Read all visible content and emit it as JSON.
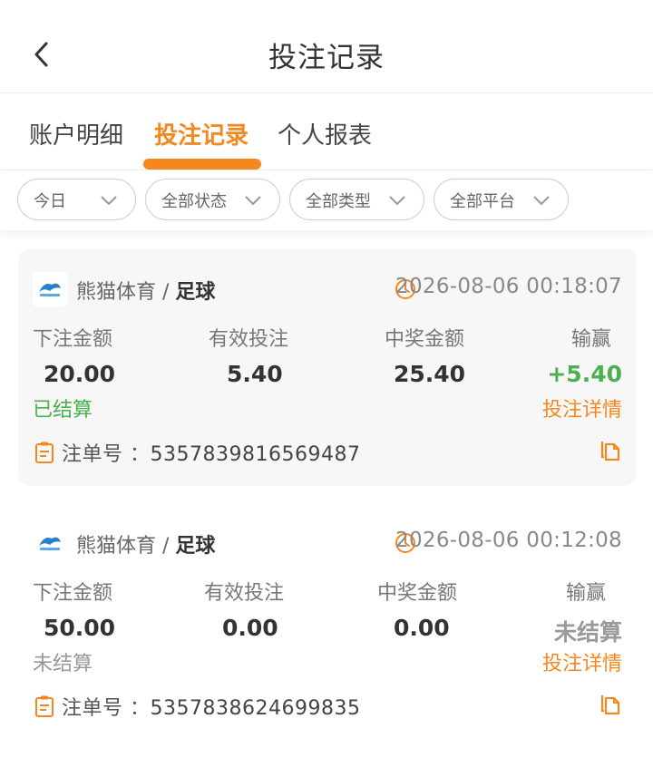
{
  "header": {
    "title": "投注记录",
    "back_icon": "chevron-left-icon"
  },
  "tabs": [
    {
      "label": "账户明细",
      "active": false
    },
    {
      "label": "投注记录",
      "active": true
    },
    {
      "label": "个人报表",
      "active": false
    }
  ],
  "filters": [
    {
      "label": "今日"
    },
    {
      "label": "全部状态"
    },
    {
      "label": "全部类型"
    },
    {
      "label": "全部平台"
    }
  ],
  "labels": {
    "bet_amount": "下注金额",
    "valid_bet": "有效投注",
    "win_amount": "中奖金额",
    "profit": "输赢",
    "detail": "投注详情",
    "order_no": "注单号"
  },
  "records": [
    {
      "platform": "熊猫体育",
      "separator": " / ",
      "sport": "足球",
      "time": "2026-08-06 00:18:07",
      "bet_amount": "20.00",
      "valid_bet": "5.40",
      "win_amount": "25.40",
      "profit": "+5.40",
      "status": "已结算",
      "order_no": "5357839816569487"
    },
    {
      "platform": "熊猫体育",
      "separator": " / ",
      "sport": "足球",
      "time": "2026-08-06 00:12:08",
      "bet_amount": "50.00",
      "valid_bet": "0.00",
      "win_amount": "0.00",
      "profit": "未结算",
      "status": "未结算",
      "order_no": "5357838624699835"
    }
  ],
  "colors": {
    "accent": "#f5871f",
    "settled": "#4caf50",
    "muted": "#999999"
  }
}
